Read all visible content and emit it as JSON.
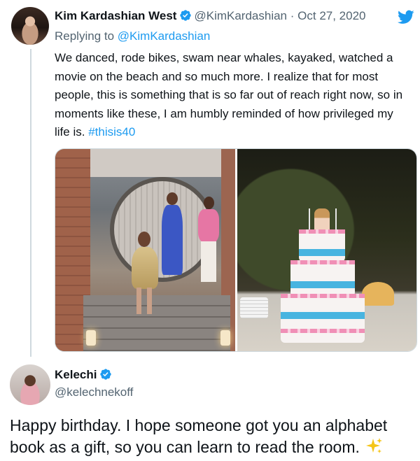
{
  "tweet1": {
    "author_name": "Kim Kardashian West",
    "handle": "@KimKardashian",
    "separator": "·",
    "date": "Oct 27, 2020",
    "replying_prefix": "Replying to ",
    "replying_to": "@KimKardashian",
    "body": "We danced, rode bikes, swam near whales, kayaked, watched a movie on the beach and so much more. I realize that for most people, this is something that is so far out of reach right now, so in moments like these, I am humbly reminded of how privileged my life is. ",
    "hashtag": "#thisis40",
    "verified_icon": "verified-badge-icon",
    "platform_icon": "twitter-bird-icon",
    "media": [
      {
        "kind": "photo",
        "subject": "party-hallway-photo"
      },
      {
        "kind": "photo",
        "subject": "birthday-cake-photo"
      }
    ]
  },
  "tweet2": {
    "author_name": "Kelechi",
    "handle": "@kelechnekoff",
    "body": "Happy birthday. I hope someone got you an alphabet book as a gift, so you can learn to read the room.",
    "emoji_icon": "sparkles-icon",
    "verified_icon": "verified-badge-icon"
  },
  "colors": {
    "link": "#1d9bf0",
    "secondary_text": "#536471",
    "primary_text": "#0f1419",
    "thread_line": "#cfd9de",
    "verified": "#1d9bf0",
    "sparkles": "#f5c518"
  }
}
